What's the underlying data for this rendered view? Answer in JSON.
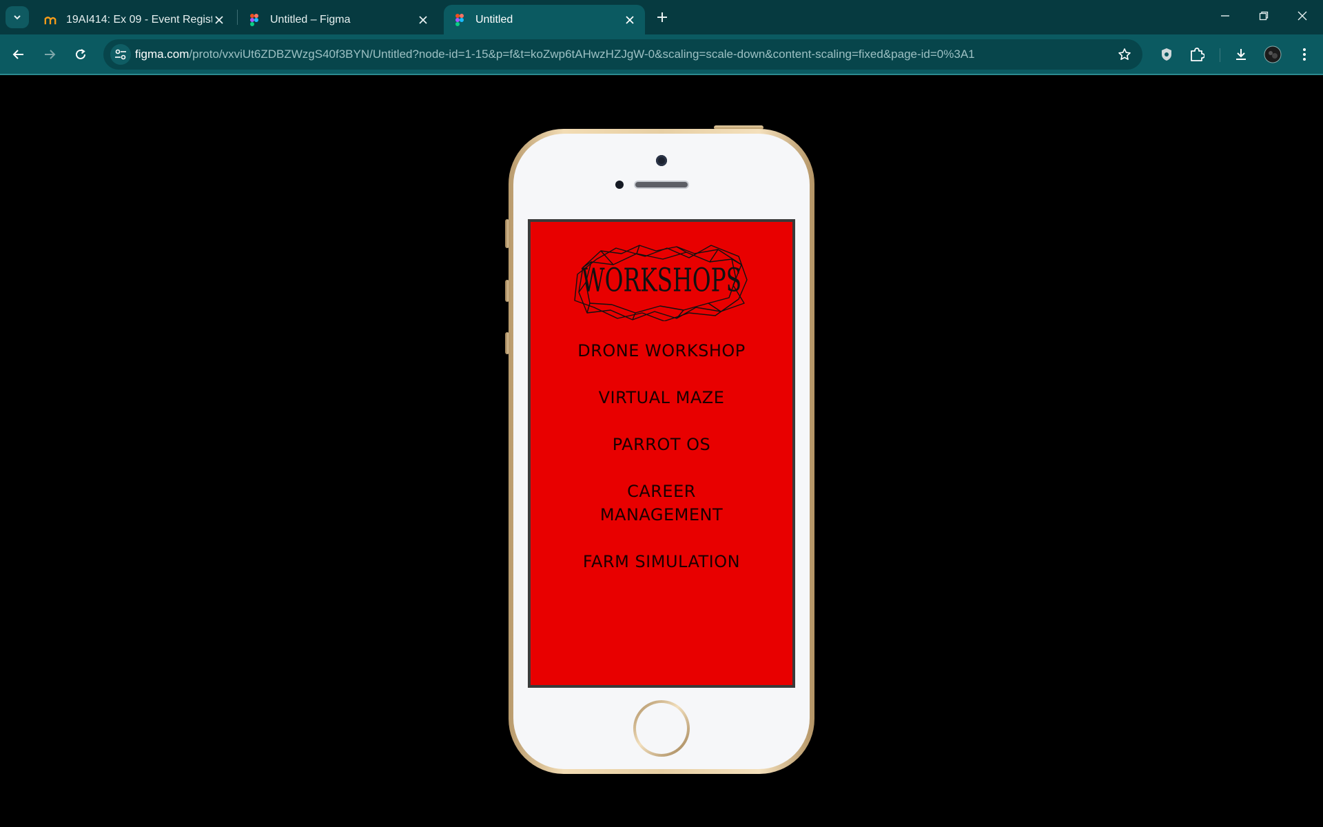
{
  "browser": {
    "tabs": [
      {
        "title": "19AI414: Ex 09 - Event Registrat",
        "favicon": "moodle-icon",
        "active": false
      },
      {
        "title": "Untitled – Figma",
        "favicon": "figma-icon",
        "active": false
      },
      {
        "title": "Untitled",
        "favicon": "figma-icon",
        "active": true
      }
    ],
    "url_host": "figma.com",
    "url_path": "/proto/vxviUt6ZDBZWzgS40f3BYN/Untitled?node-id=1-15&p=f&t=koZwp6tAHwzHZJgW-0&scaling=scale-down&content-scaling=fixed&page-id=0%3A1"
  },
  "prototype": {
    "logo_text": "WORKSHOPS",
    "menu_items": [
      "DRONE WORKSHOP",
      "VIRTUAL MAZE",
      "PARROT OS",
      "CAREER\nMANAGEMENT",
      "FARM SIMULATION"
    ],
    "screen_color": "#e80000"
  }
}
